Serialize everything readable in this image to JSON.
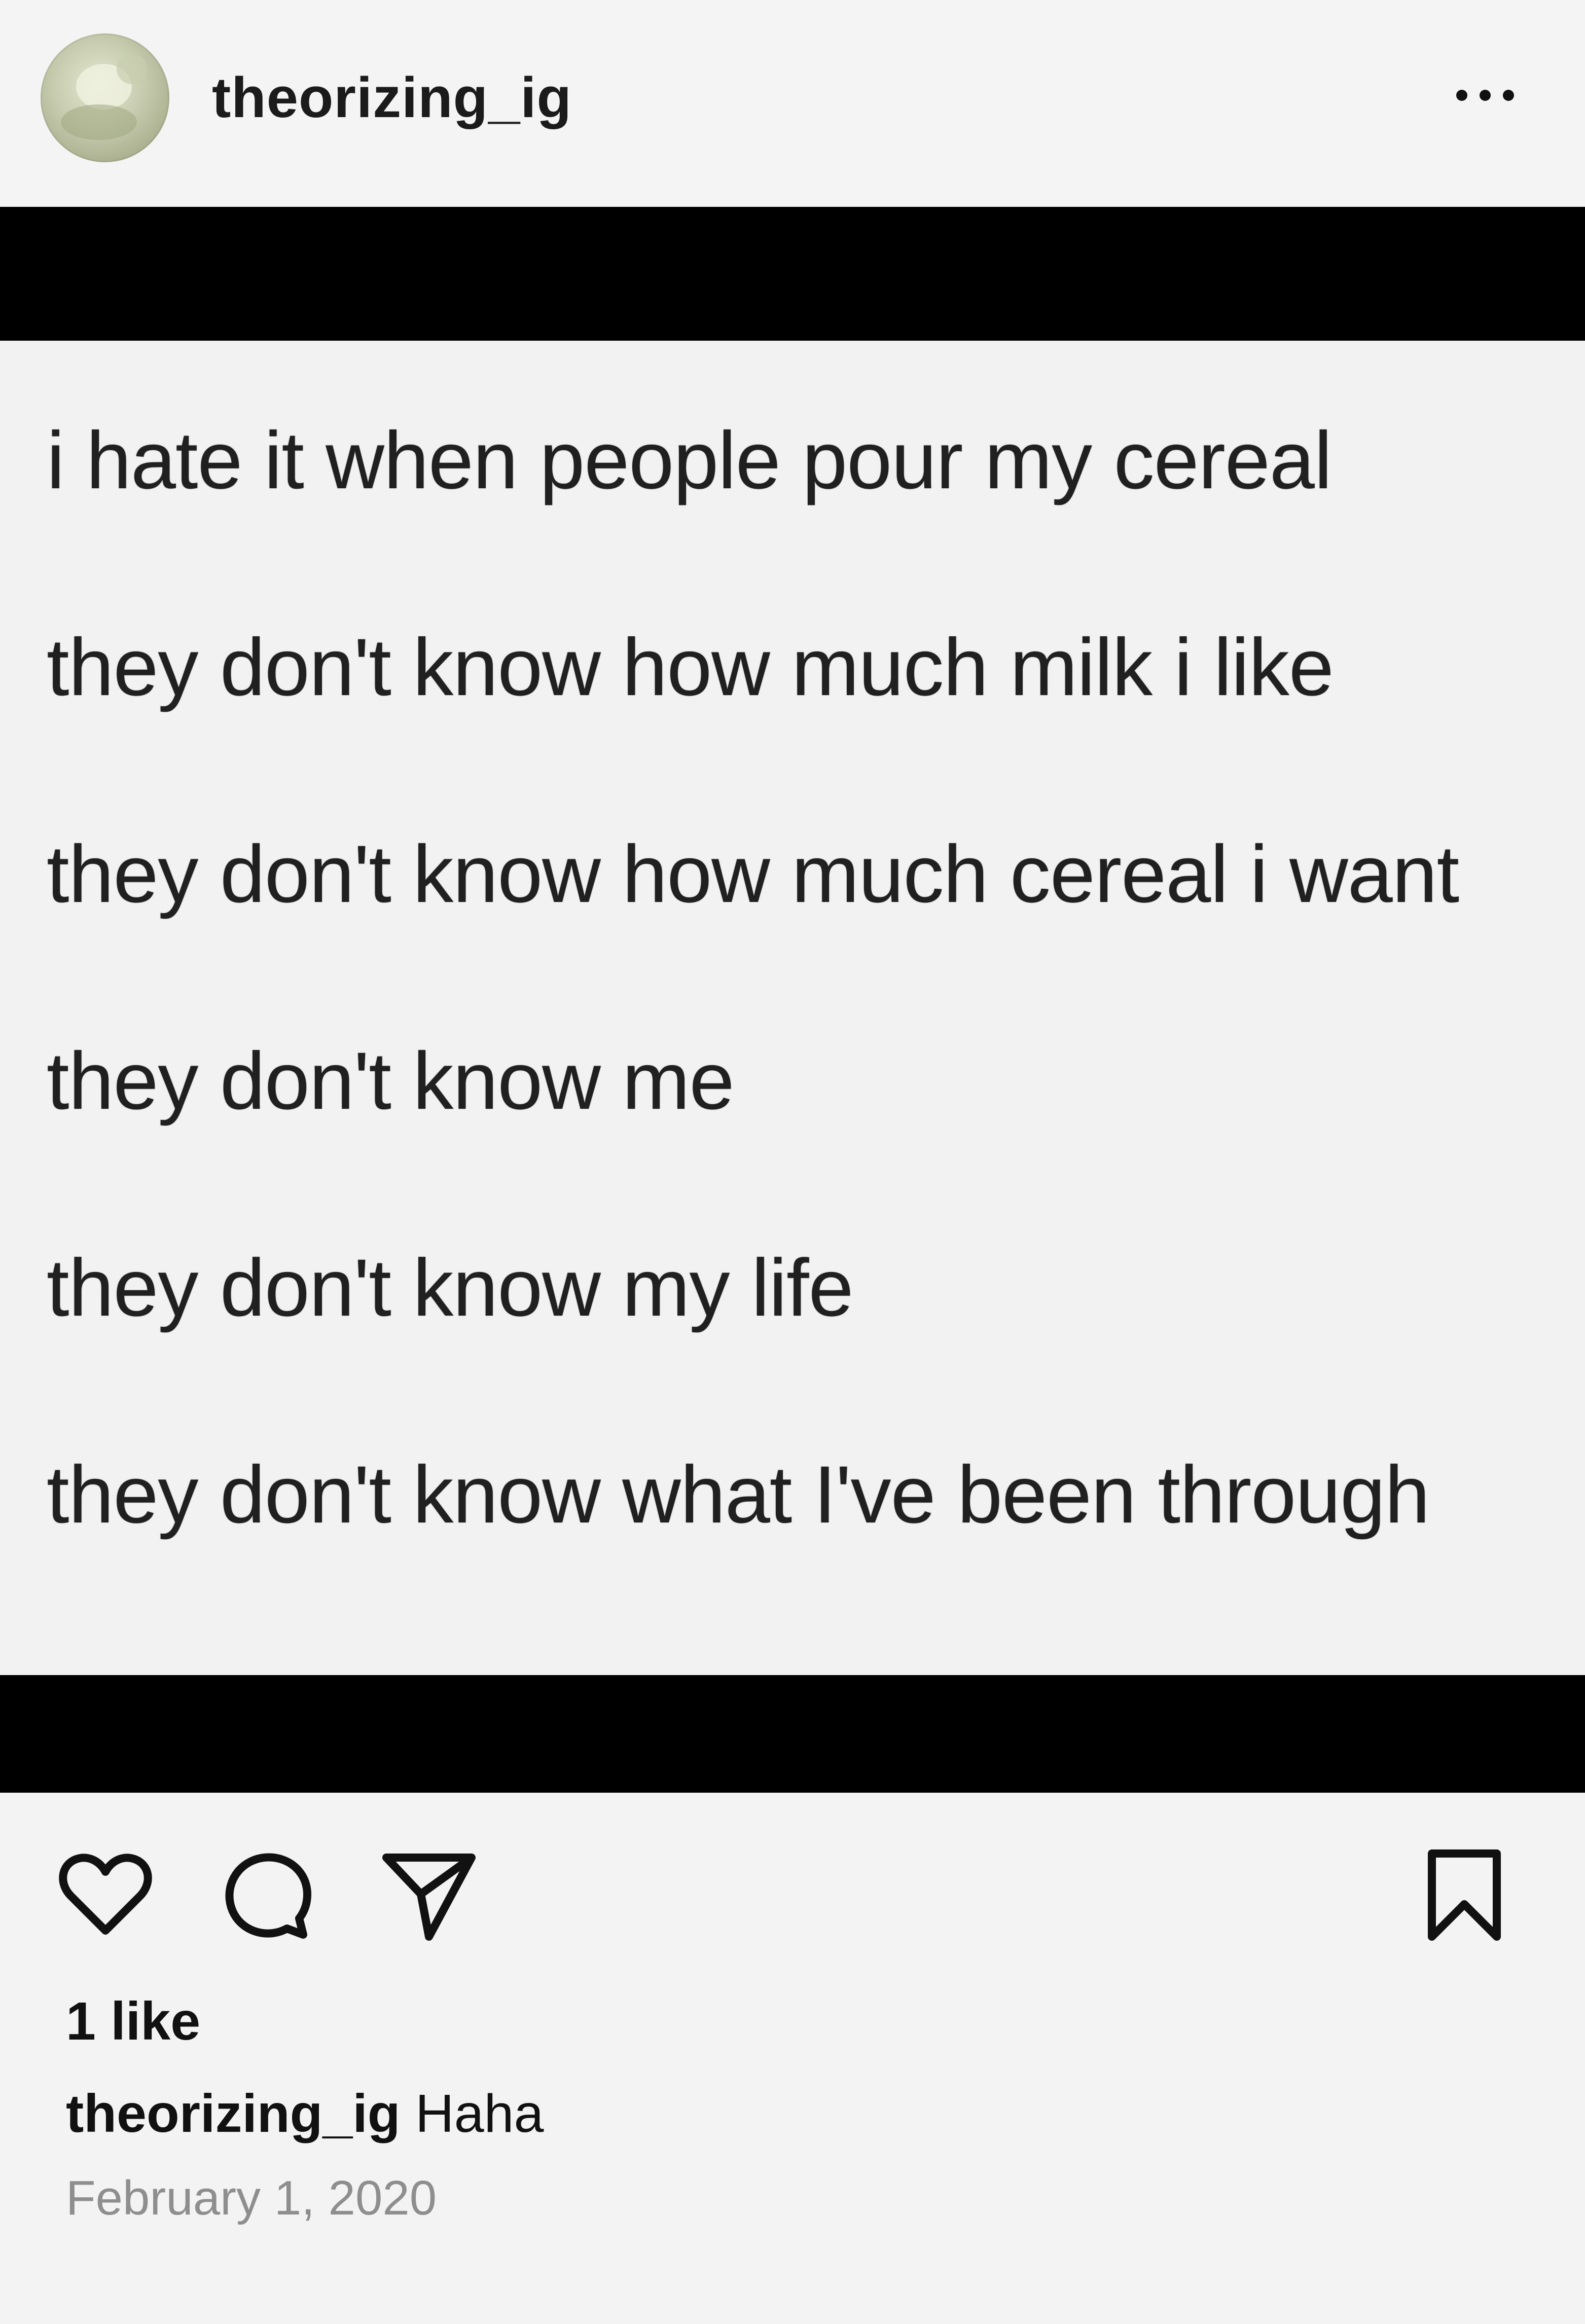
{
  "header": {
    "username": "theorizing_ig",
    "more_icon": "more-horizontal-icon"
  },
  "post": {
    "lines": [
      "i hate it when people pour my cereal",
      "they don't know how much milk i like",
      "they don't know how much cereal i want",
      "they don't know me",
      "they don't know my life",
      "they don't know what I've been through"
    ]
  },
  "actions": {
    "icons": [
      "heart-icon",
      "comment-icon",
      "share-icon",
      "bookmark-icon"
    ]
  },
  "likes": "1 like",
  "caption": {
    "username": "theorizing_ig",
    "text": "Haha"
  },
  "date": "February 1, 2020"
}
